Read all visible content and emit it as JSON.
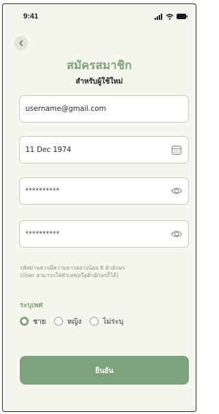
{
  "status_bar": {
    "time": "9:41"
  },
  "header": {
    "title": "สมัครสมาชิก",
    "subtitle": "สำหรับผู้ใช้ใหม่"
  },
  "form": {
    "email": {
      "value": "username@gmail.com"
    },
    "birthdate": {
      "value": "11 Dec 1974",
      "icon": "calendar-icon"
    },
    "password": {
      "value": "**********",
      "icon": "eye-icon"
    },
    "confirm_password": {
      "value": "**********",
      "icon": "eye-icon"
    },
    "password_hint": [
      "รหัสผ่านควรมีความยาวอย่างน้อย 8 ตัวอักษร",
      "(User สามารถใส่ตัวเลขหรือตัวอักษรก็ได้)"
    ]
  },
  "gender": {
    "label": "ระบุเพศ",
    "options": [
      {
        "label": "ชาย",
        "selected": true
      },
      {
        "label": "หญิง",
        "selected": false
      },
      {
        "label": "ไม่ระบุ",
        "selected": false
      }
    ]
  },
  "submit": {
    "label": "ยืนยัน"
  },
  "colors": {
    "accent": "#7ea17b",
    "background": "#f6f6ef",
    "field_border": "#bcd0b7",
    "hint_text": "#8d8d87"
  }
}
